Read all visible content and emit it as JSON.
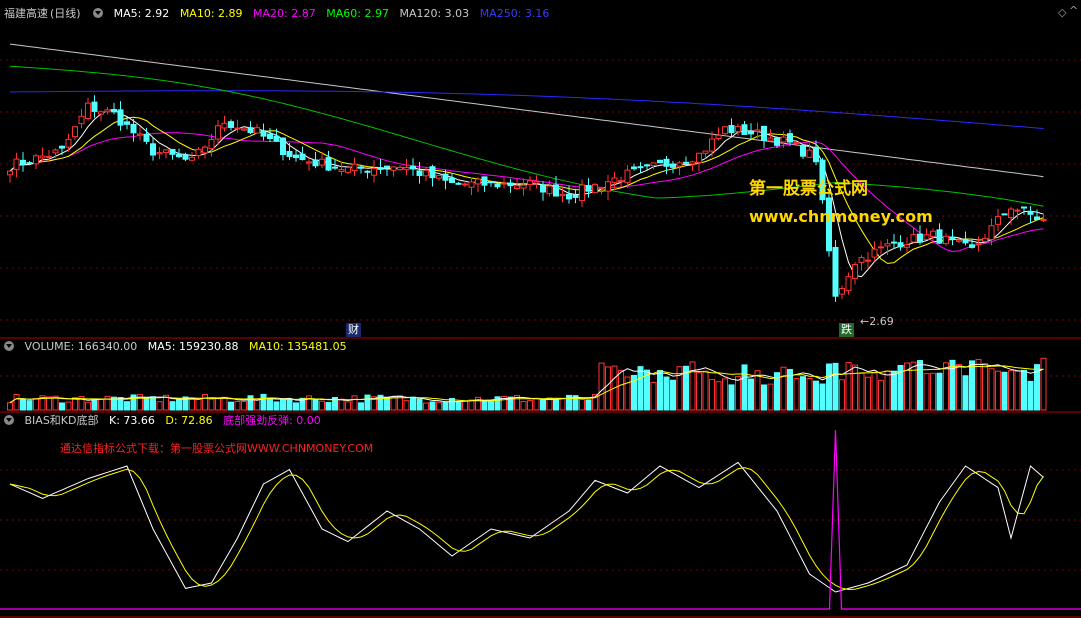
{
  "header": {
    "title": "福建高速",
    "period": "(日线)",
    "ma": [
      {
        "label": "MA5: 2.92",
        "color": "#ffffff"
      },
      {
        "label": "MA10: 2.89",
        "color": "#ffff00"
      },
      {
        "label": "MA20: 2.87",
        "color": "#ff00ff"
      },
      {
        "label": "MA60: 2.97",
        "color": "#00ff00"
      },
      {
        "label": "MA120: 3.03",
        "color": "#c8c8c8"
      },
      {
        "label": "MA250: 3.16",
        "color": "#0000ff"
      }
    ]
  },
  "watermark": {
    "line1": "第一股票公式网",
    "line2": "www.chnmoney.com"
  },
  "annotations": {
    "cai": "财",
    "die": "跌",
    "low": "2.69"
  },
  "volume_header": {
    "label": "VOLUME: 166340.00",
    "ma5": "MA5: 159230.88",
    "ma10": "MA10: 135481.05"
  },
  "ind_header": {
    "name": "BIAS和KD底部",
    "k": "K: 73.66",
    "d": "D: 72.86",
    "sig": "底部强劲反弹: 0.00"
  },
  "ind_note": "通达信指标公式下载：第一股票公式网WWW.CHNMONEY.COM",
  "chart_data": {
    "type": "candlestick",
    "title": "福建高速 (日线)",
    "price_range": [
      2.6,
      3.45
    ],
    "low_marker": 2.69,
    "ma_latest": {
      "MA5": 2.92,
      "MA10": 2.89,
      "MA20": 2.87,
      "MA60": 2.97,
      "MA120": 3.03,
      "MA250": 3.16
    },
    "price_anchors": [
      {
        "i": 0,
        "p": 3.06
      },
      {
        "i": 8,
        "p": 3.1
      },
      {
        "i": 12,
        "p": 3.22
      },
      {
        "i": 16,
        "p": 3.2
      },
      {
        "i": 22,
        "p": 3.1
      },
      {
        "i": 28,
        "p": 3.07
      },
      {
        "i": 33,
        "p": 3.18
      },
      {
        "i": 38,
        "p": 3.15
      },
      {
        "i": 44,
        "p": 3.08
      },
      {
        "i": 52,
        "p": 3.05
      },
      {
        "i": 60,
        "p": 3.06
      },
      {
        "i": 68,
        "p": 3.01
      },
      {
        "i": 80,
        "p": 3.01
      },
      {
        "i": 86,
        "p": 2.98
      },
      {
        "i": 94,
        "p": 3.03
      },
      {
        "i": 100,
        "p": 3.06
      },
      {
        "i": 106,
        "p": 3.09
      },
      {
        "i": 110,
        "p": 3.16
      },
      {
        "i": 114,
        "p": 3.15
      },
      {
        "i": 120,
        "p": 3.12
      },
      {
        "i": 124,
        "p": 3.08
      },
      {
        "i": 127,
        "p": 2.7
      },
      {
        "i": 130,
        "p": 2.8
      },
      {
        "i": 136,
        "p": 2.85
      },
      {
        "i": 142,
        "p": 2.87
      },
      {
        "i": 148,
        "p": 2.83
      },
      {
        "i": 154,
        "p": 2.95
      },
      {
        "i": 159,
        "p": 2.91
      }
    ],
    "volume_latest": 166340.0,
    "volume_ma": {
      "MA5": 159230.88,
      "MA10": 135481.05
    },
    "indicator": {
      "name": "BIAS和KD底部",
      "K": 73.66,
      "D": 72.86,
      "bottom_rebound": 0.0,
      "k_anchors": [
        {
          "i": 0,
          "v": 70
        },
        {
          "i": 5,
          "v": 62
        },
        {
          "i": 12,
          "v": 73
        },
        {
          "i": 18,
          "v": 80
        },
        {
          "i": 22,
          "v": 45
        },
        {
          "i": 27,
          "v": 12
        },
        {
          "i": 31,
          "v": 15
        },
        {
          "i": 35,
          "v": 40
        },
        {
          "i": 39,
          "v": 70
        },
        {
          "i": 43,
          "v": 78
        },
        {
          "i": 48,
          "v": 45
        },
        {
          "i": 52,
          "v": 38
        },
        {
          "i": 58,
          "v": 55
        },
        {
          "i": 63,
          "v": 45
        },
        {
          "i": 68,
          "v": 30
        },
        {
          "i": 74,
          "v": 45
        },
        {
          "i": 80,
          "v": 40
        },
        {
          "i": 86,
          "v": 55
        },
        {
          "i": 90,
          "v": 72
        },
        {
          "i": 95,
          "v": 65
        },
        {
          "i": 100,
          "v": 80
        },
        {
          "i": 106,
          "v": 68
        },
        {
          "i": 112,
          "v": 82
        },
        {
          "i": 118,
          "v": 55
        },
        {
          "i": 123,
          "v": 20
        },
        {
          "i": 127,
          "v": 10
        },
        {
          "i": 132,
          "v": 15
        },
        {
          "i": 138,
          "v": 25
        },
        {
          "i": 143,
          "v": 60
        },
        {
          "i": 147,
          "v": 80
        },
        {
          "i": 152,
          "v": 68
        },
        {
          "i": 154,
          "v": 40
        },
        {
          "i": 157,
          "v": 80
        },
        {
          "i": 159,
          "v": 73.66
        }
      ],
      "spike": {
        "i": 127,
        "v": 100
      }
    }
  }
}
